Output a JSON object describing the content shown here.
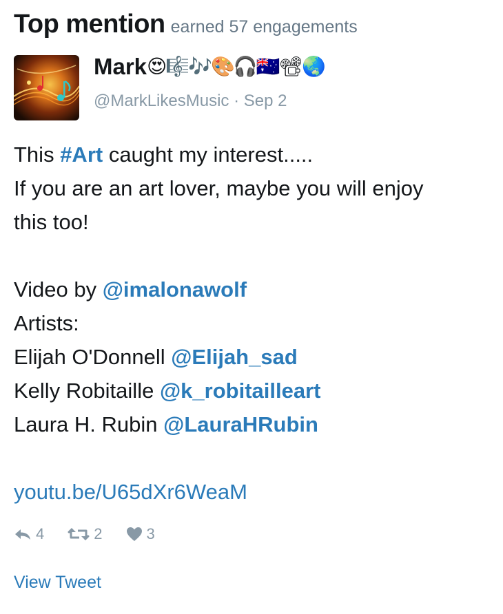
{
  "header": {
    "title": "Top mention",
    "subtitle": "earned 57 engagements"
  },
  "tweet": {
    "author_name": "Mark",
    "author_emojis": "😍🎼🎶🎨🎧🇦🇺📽🌏",
    "handle": "@MarkLikesMusic",
    "separator": " · ",
    "date": "Sep 2",
    "lines": {
      "l1_pre": "This ",
      "l1_tag": "#Art",
      "l1_post": " caught my interest.....",
      "l2": "If you are an art lover, maybe you will enjoy",
      "l3": "this too!",
      "l5_pre": "Video by ",
      "l5_mention": "@imalonawolf",
      "l6": "Artists:",
      "l7_pre": "Elijah O'Donnell ",
      "l7_mention": "@Elijah_sad",
      "l8_pre": "Kelly Robitaille ",
      "l8_mention": "@k_robitailleart",
      "l9_pre": "Laura H. Rubin ",
      "l9_mention": "@LauraHRubin",
      "link": "youtu.be/U65dXr6WeaM"
    },
    "actions": {
      "reply_count": "4",
      "retweet_count": "2",
      "like_count": "3"
    },
    "view_label": "View Tweet",
    "colors": {
      "link": "#2b7bb9",
      "muted": "#8899a6",
      "text": "#14171a"
    }
  }
}
